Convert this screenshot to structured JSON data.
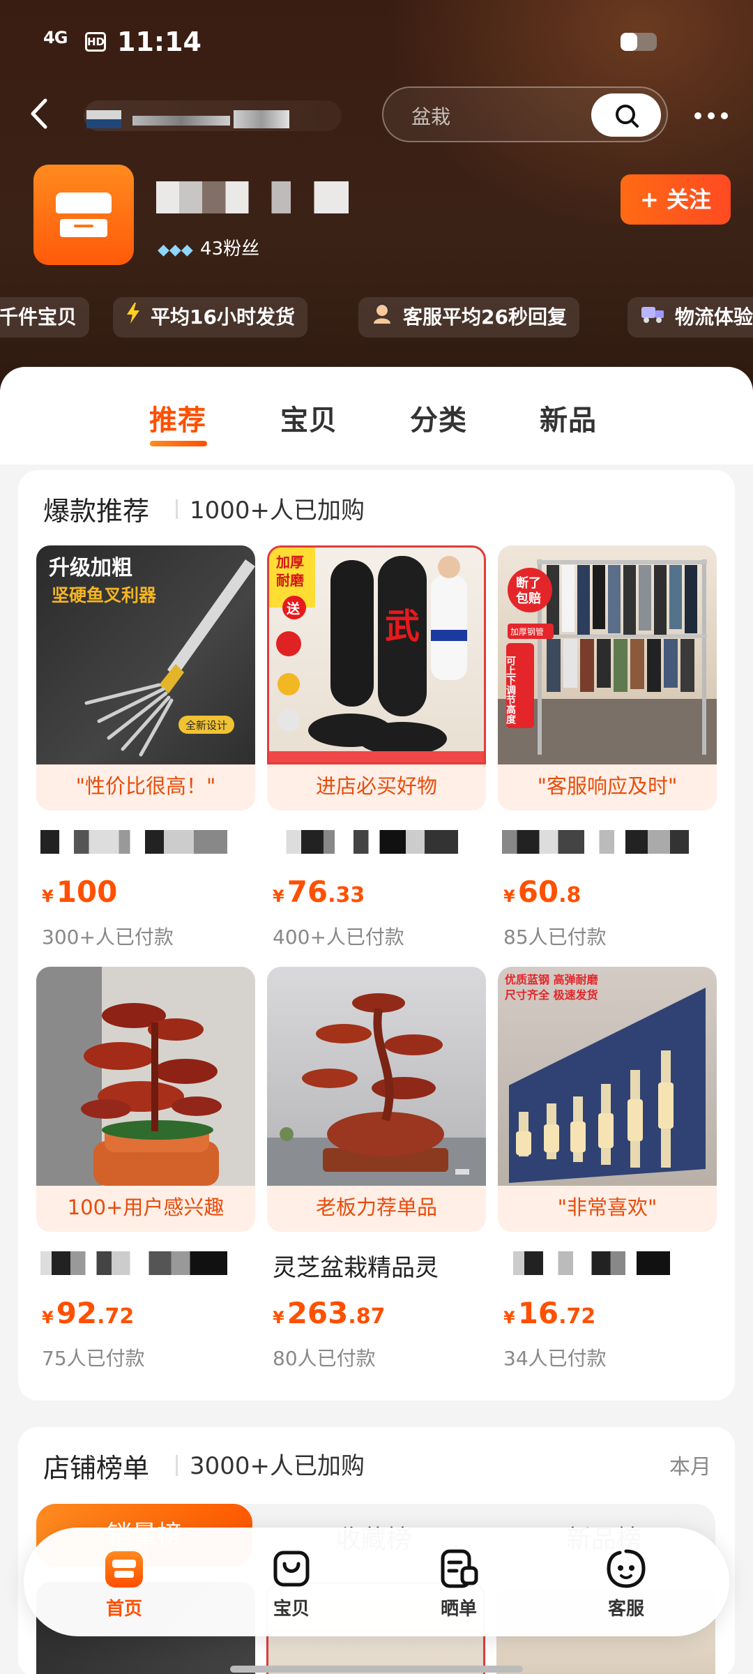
{
  "status_bar": {
    "network": "4G",
    "hd_label": "HD",
    "time": "11:14"
  },
  "header": {
    "back_icon": "chevron-left-icon",
    "search_placeholder": "盆栽",
    "search_icon": "search-icon",
    "more_icon": "more-dots-icon"
  },
  "shop": {
    "logo_icon": "storefront-icon",
    "diamonds": "◆◆◆",
    "fans": "43粉丝",
    "follow_label": "+ 关注"
  },
  "tags": [
    {
      "icon": "",
      "label": "千件宝贝"
    },
    {
      "icon": "lightning-icon",
      "label": "平均16小时发货"
    },
    {
      "icon": "customer-service-icon",
      "label": "客服平均26秒回复"
    },
    {
      "icon": "truck-icon",
      "label": "物流体验"
    }
  ],
  "tabs": [
    {
      "label": "推荐",
      "active": true
    },
    {
      "label": "宝贝",
      "active": false
    },
    {
      "label": "分类",
      "active": false
    },
    {
      "label": "新品",
      "active": false
    }
  ],
  "hot_section": {
    "title": "爆款推荐",
    "subtitle": "1000+人已加购",
    "products": [
      {
        "label": "\"性价比很高！\"",
        "name": "",
        "price_int": "100",
        "price_dec": "",
        "sold": "300+人已付款",
        "image_text": {
          "line1": "升级加粗",
          "line2": "坚硬鱼叉利器",
          "badge": "全新设计"
        }
      },
      {
        "label": "进店必买好物",
        "name": "",
        "price_int": "76",
        "price_dec": ".33",
        "sold": "400+人已付款",
        "image_text": {
          "line1": "加厚",
          "line2": "耐磨",
          "badge": "送",
          "center": "武"
        }
      },
      {
        "label": "\"客服响应及时\"",
        "name": "",
        "price_int": "60",
        "price_dec": ".8",
        "sold": "85人已付款",
        "image_text": {
          "line1": "断了",
          "line2": "包赔",
          "badge": "加厚钢管",
          "side": "可上下调节高度"
        }
      },
      {
        "label": "100+用户感兴趣",
        "name": "",
        "price_int": "92",
        "price_dec": ".72",
        "sold": "75人已付款",
        "image_text": {}
      },
      {
        "label": "老板力荐单品",
        "name": "灵芝盆栽精品灵",
        "price_int": "263",
        "price_dec": ".87",
        "sold": "80人已付款",
        "image_text": {}
      },
      {
        "label": "\"非常喜欢\"",
        "name": "",
        "price_int": "16",
        "price_dec": ".72",
        "sold": "34人已付款",
        "image_text": {
          "line1": "优质蓝钢 高弹耐磨",
          "line2": "尺寸齐全 极速发货"
        }
      }
    ]
  },
  "rank_section": {
    "title": "店铺榜单",
    "subtitle": "3000+人已加购",
    "period": "本月",
    "tabs": [
      "销量榜",
      "收藏榜",
      "新品榜"
    ]
  },
  "currency": "¥",
  "bottom_nav": [
    {
      "label": "首页",
      "icon": "shop-home-icon",
      "active": true
    },
    {
      "label": "宝贝",
      "icon": "bag-icon",
      "active": false
    },
    {
      "label": "晒单",
      "icon": "review-icon",
      "active": false
    },
    {
      "label": "客服",
      "icon": "service-face-icon",
      "active": false
    }
  ],
  "colors": {
    "accent": "#ff5000",
    "header_bg": "#3a1d12",
    "label_bg": "#ffefe6"
  }
}
